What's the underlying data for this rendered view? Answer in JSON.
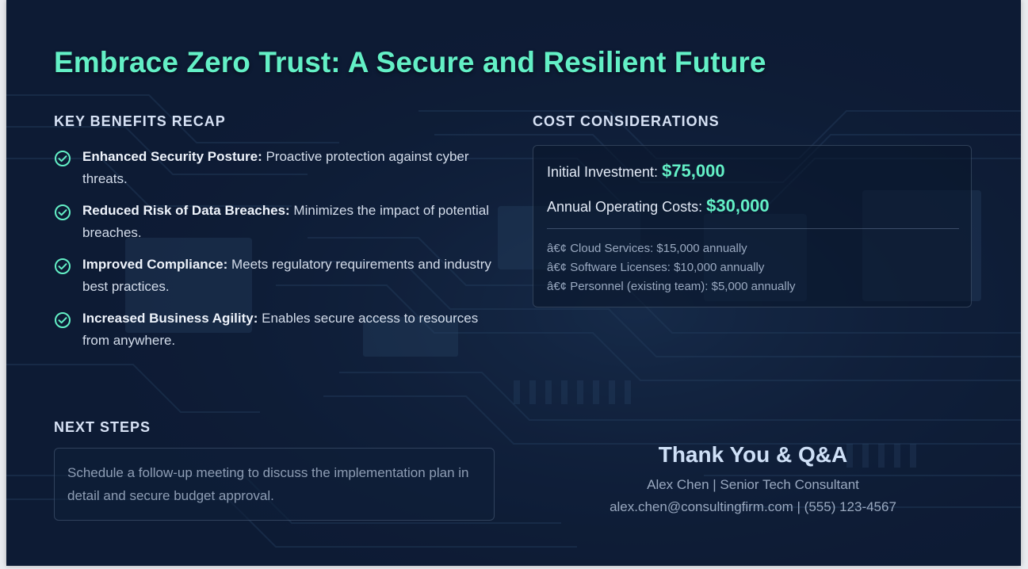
{
  "slide": {
    "title": "Embrace Zero Trust: A Secure and Resilient Future",
    "benefits": {
      "heading": "KEY BENEFITS RECAP",
      "icon": "check-circle-icon",
      "accent_color": "#63f0c6",
      "items": [
        {
          "name": "Enhanced Security Posture:",
          "description": " Proactive protection against cyber threats."
        },
        {
          "name": "Reduced Risk of Data Breaches:",
          "description": " Minimizes the impact of potential breaches."
        },
        {
          "name": "Improved Compliance:",
          "description": " Meets regulatory requirements and industry best practices."
        },
        {
          "name": "Increased Business Agility:",
          "description": " Enables secure access to resources from anywhere."
        }
      ]
    },
    "costs": {
      "heading": "COST CONSIDERATIONS",
      "initial_label": "Initial Investment: ",
      "initial_value": "$75,000",
      "annual_label": "Annual Operating Costs: ",
      "annual_value": "$30,000",
      "breakdown": [
        "â€¢ Cloud Services: $15,000 annually",
        "â€¢ Software Licenses: $10,000 annually",
        "â€¢ Personnel (existing team): $5,000 annually"
      ]
    },
    "next_steps": {
      "heading": "NEXT STEPS",
      "text": "Schedule a follow-up meeting to discuss the implementation plan in detail and secure budget approval."
    },
    "closing": {
      "thanks": "Thank You & Q&A",
      "presenter": "Alex Chen | Senior Tech Consultant",
      "contact": "alex.chen@consultingfirm.com | (555) 123-4567"
    },
    "colors": {
      "background": "#0d1b34",
      "accent": "#63f0c6",
      "heading": "#d7e2f5",
      "muted": "#9aa9c0"
    }
  }
}
